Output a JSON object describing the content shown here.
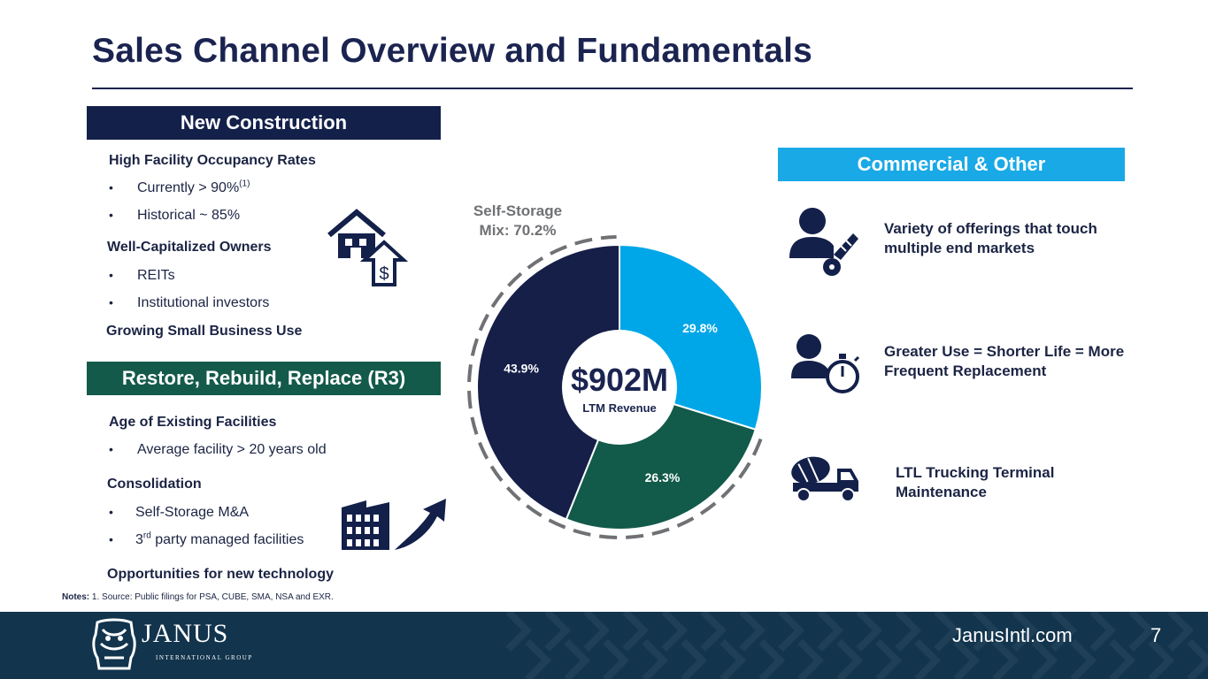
{
  "title": "Sales Channel Overview and Fundamentals",
  "new_construction": {
    "header": "New Construction",
    "groups": [
      {
        "heading": "High Facility Occupancy Rates",
        "bullets": [
          {
            "text": "Currently > 90%",
            "sup": "(1)"
          },
          {
            "text": "Historical ~ 85%"
          }
        ]
      },
      {
        "heading": "Well-Capitalized Owners",
        "bullets": [
          {
            "text": "REITs"
          },
          {
            "text": "Institutional investors"
          }
        ]
      },
      {
        "heading": "Growing Small Business Use",
        "bullets": []
      }
    ],
    "icon": "house-dollar-icon"
  },
  "r3": {
    "header": "Restore, Rebuild, Replace (R3)",
    "groups": [
      {
        "heading": "Age of Existing Facilities",
        "bullets": [
          {
            "text": "Average facility > 20 years old"
          }
        ]
      },
      {
        "heading": "Consolidation",
        "bullets": [
          {
            "text": "Self-Storage M&A"
          },
          {
            "pre": "3",
            "sup": "rd",
            "text": " party managed facilities"
          }
        ]
      },
      {
        "heading": "Opportunities for new technology",
        "bullets": []
      }
    ],
    "icon": "building-growth-icon"
  },
  "commercial": {
    "header": "Commercial & Other",
    "items": [
      {
        "text": "Variety of offerings that touch multiple end markets",
        "icon": "person-key-icon"
      },
      {
        "text": "Greater Use = Shorter Life = More Frequent Replacement",
        "icon": "person-stopwatch-icon"
      },
      {
        "text": "LTL Trucking Terminal Maintenance",
        "icon": "cement-truck-icon"
      }
    ]
  },
  "chart_data": {
    "type": "pie",
    "subtype": "donut",
    "categories": [
      "Commercial & Other",
      "Restore, Rebuild, Replace (R3)",
      "New Construction"
    ],
    "values": [
      29.8,
      26.3,
      43.9
    ],
    "labels": [
      "29.8%",
      "26.3%",
      "43.9%"
    ],
    "colors": [
      "#00a7e8",
      "#125a4a",
      "#151f48"
    ],
    "center_value": "$902M",
    "center_label": "LTM Revenue",
    "annotation": "Self-Storage\nMix: 70.2%",
    "annotation_line1": "Self-Storage",
    "annotation_line2": "Mix: 70.2%"
  },
  "notes": {
    "label": "Notes:",
    "text": "1. Source: Public filings for PSA, CUBE, SMA, NSA and EXR."
  },
  "footer": {
    "brand": "JANUS",
    "brand_sub": "INTERNATIONAL GROUP",
    "url": "JanusIntl.com",
    "page_number": "7",
    "background": "#12344d"
  }
}
